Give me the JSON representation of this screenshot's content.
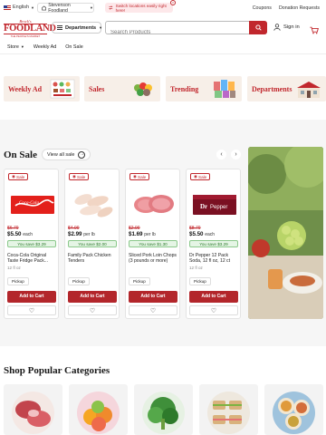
{
  "topbar": {
    "language": "English",
    "store_name": "Stevenson Foodland",
    "tooltip": "Switch locations easily right here!",
    "coupons": "Coupons",
    "donation": "Donation Requests"
  },
  "header": {
    "logo_small": "Brock's",
    "logo_main": "FOODLAND",
    "logo_tag": "THE PEOPLE'S MARKET",
    "departments": "Departments",
    "search_placeholder": "Search Products",
    "sign_in": "Sign in"
  },
  "subnav": {
    "store": "Store",
    "weekly_ad": "Weekly Ad",
    "on_sale": "On Sale"
  },
  "banners": [
    {
      "label": "Weekly Ad"
    },
    {
      "label": "Sales"
    },
    {
      "label": "Trending"
    },
    {
      "label": "Departments"
    }
  ],
  "sale_section": {
    "title": "On Sale",
    "view_all": "View all sale",
    "products": [
      {
        "badge": "Sale",
        "old_price": "$6.79",
        "price": "$5.50",
        "unit": "each",
        "save": "You save $3.29",
        "name": "Coca-Cola Original Taste Fridge Pack...",
        "size": "12 fl oz",
        "pickup": "Pickup",
        "add": "Add to Cart"
      },
      {
        "badge": "Sale",
        "old_price": "$4.99",
        "price": "$2.99",
        "unit": "per lb",
        "save": "You save $2.00",
        "name": "Family Pack Chicken Tenders",
        "size": "",
        "pickup": "Pickup",
        "add": "Add to Cart"
      },
      {
        "badge": "Sale",
        "old_price": "$2.99",
        "price": "$1.69",
        "unit": "per lb",
        "save": "You save $1.30",
        "name": "Sliced Pork Loin Chops (3 pounds or more)",
        "size": "",
        "pickup": "Pickup",
        "add": "Add to Cart"
      },
      {
        "badge": "Sale",
        "old_price": "$8.79",
        "price": "$5.50",
        "unit": "each",
        "save": "You save $3.29",
        "name": "Dr Pepper 12 Pack Soda, 12 fl oz, 12 ct",
        "size": "12 fl oz",
        "pickup": "Pickup",
        "add": "Add to Cart"
      }
    ]
  },
  "categories": {
    "title": "Shop Popular Categories"
  },
  "colors": {
    "brand": "#c1272d",
    "save_green": "#2b7a2b"
  }
}
